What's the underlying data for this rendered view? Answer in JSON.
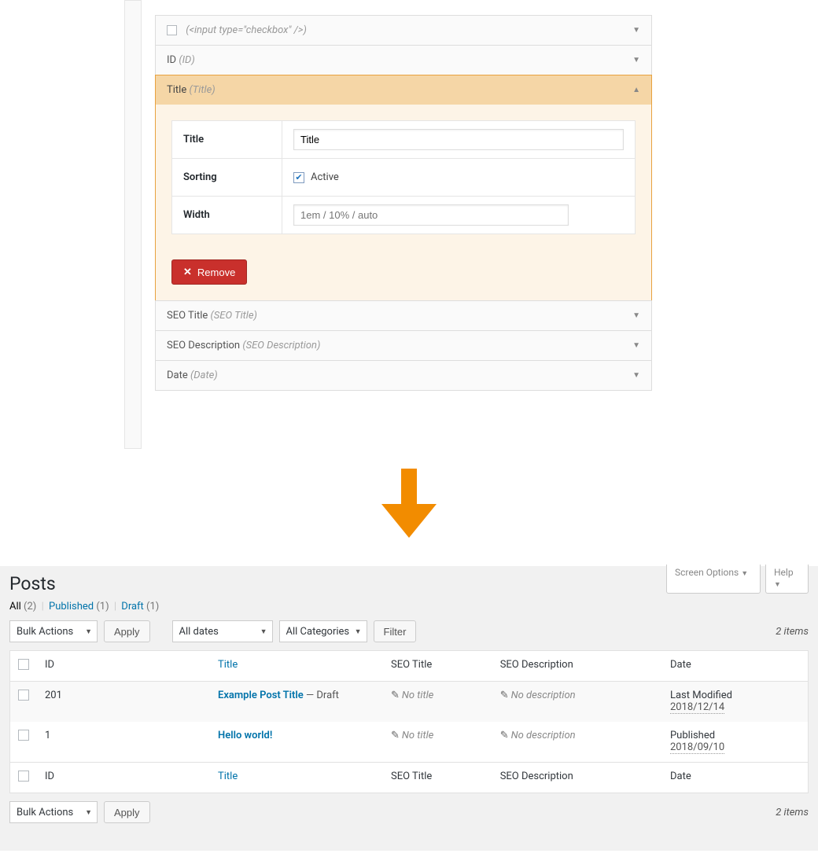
{
  "accordion": {
    "checkbox_row": {
      "code": "(<input type=\"checkbox\" />)"
    },
    "id_row": {
      "label": "ID",
      "slug": "(ID)"
    },
    "title_row": {
      "label": "Title",
      "slug": "(Title)",
      "fields": {
        "title_label": "Title",
        "title_value": "Title",
        "sorting_label": "Sorting",
        "sorting_active": "Active",
        "width_label": "Width",
        "width_placeholder": "1em / 10% / auto"
      },
      "remove_label": "Remove"
    },
    "seo_title_row": {
      "label": "SEO Title",
      "slug": "(SEO Title)"
    },
    "seo_desc_row": {
      "label": "SEO Description",
      "slug": "(SEO Description)"
    },
    "date_row": {
      "label": "Date",
      "slug": "(Date)"
    }
  },
  "posts": {
    "title": "Posts",
    "screen_options": "Screen Options",
    "help": "Help",
    "filters": {
      "all": "All",
      "all_count": "(2)",
      "published": "Published",
      "published_count": "(1)",
      "draft": "Draft",
      "draft_count": "(1)"
    },
    "bulk_actions": "Bulk Actions",
    "apply": "Apply",
    "all_dates": "All dates",
    "all_categories": "All Categories",
    "filter": "Filter",
    "items_text": "2 items",
    "columns": {
      "id": "ID",
      "title": "Title",
      "seo_title": "SEO Title",
      "seo_desc": "SEO Description",
      "date": "Date"
    },
    "rows": [
      {
        "id": "201",
        "title": "Example Post Title",
        "status": " — Draft",
        "seo_title": "No title",
        "seo_desc": "No description",
        "date_label": "Last Modified",
        "date_value": "2018/12/14"
      },
      {
        "id": "1",
        "title": "Hello world!",
        "status": "",
        "seo_title": "No title",
        "seo_desc": "No description",
        "date_label": "Published",
        "date_value": "2018/09/10"
      }
    ]
  }
}
